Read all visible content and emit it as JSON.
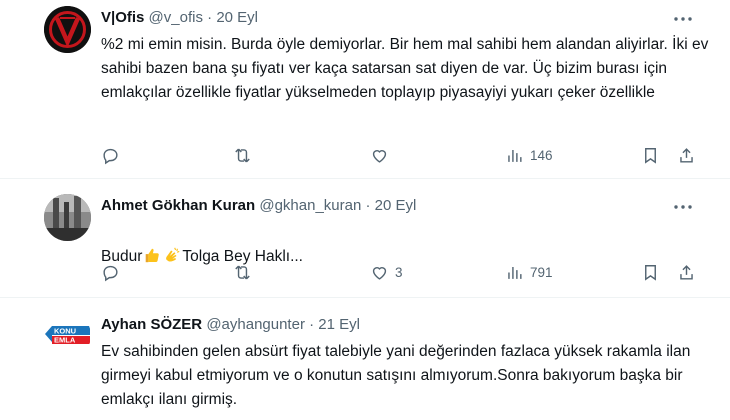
{
  "tweets": [
    {
      "author_name": "V|Ofis",
      "handle": "@v_ofis",
      "date": "20 Eyl",
      "text": "%2 mi emin misin. Burda öyle demiyorlar. Bir hem mal sahibi hem alandan aliyirlar. İki ev sahibi bazen bana şu fiyatı ver kaça satarsan sat diyen de var. Üç bizim burası için emlakçılar özellikle fiyatlar yükselmeden toplayıp piyasayiyi yukarı çeker özellikle",
      "reply_count": "",
      "retweet_count": "",
      "like_count": "",
      "view_count": "146"
    },
    {
      "author_name": "Ahmet Gökhan Kuran",
      "handle": "@gkhan_kuran",
      "date": "20 Eyl",
      "text_prefix": "Budur",
      "text_suffix": "Tolga Bey Haklı...",
      "emoji_1": "thumbs-up",
      "emoji_2": "clapping-hands",
      "reply_count": "",
      "retweet_count": "",
      "like_count": "3",
      "view_count": "791"
    },
    {
      "author_name": "Ayhan SÖZER",
      "handle": "@ayhangunter",
      "date": "21 Eyl",
      "avatar_logo_text": "KONU EMLA",
      "text": "Ev sahibinden gelen absürt fiyat talebiyle yani değerinden fazlaca yüksek rakamla ilan girmeyi kabul etmiyorum ve o konutun satışını almıyorum.Sonra bakıyorum başka bir emlakçı ilanı girmiş."
    }
  ],
  "separator": "·",
  "colors": {
    "text": "#0f1419",
    "secondary": "#536471",
    "divider": "#eff3f4"
  },
  "icons": [
    "reply-icon",
    "retweet-icon",
    "like-icon",
    "views-icon",
    "bookmark-icon",
    "share-icon",
    "more-icon"
  ]
}
